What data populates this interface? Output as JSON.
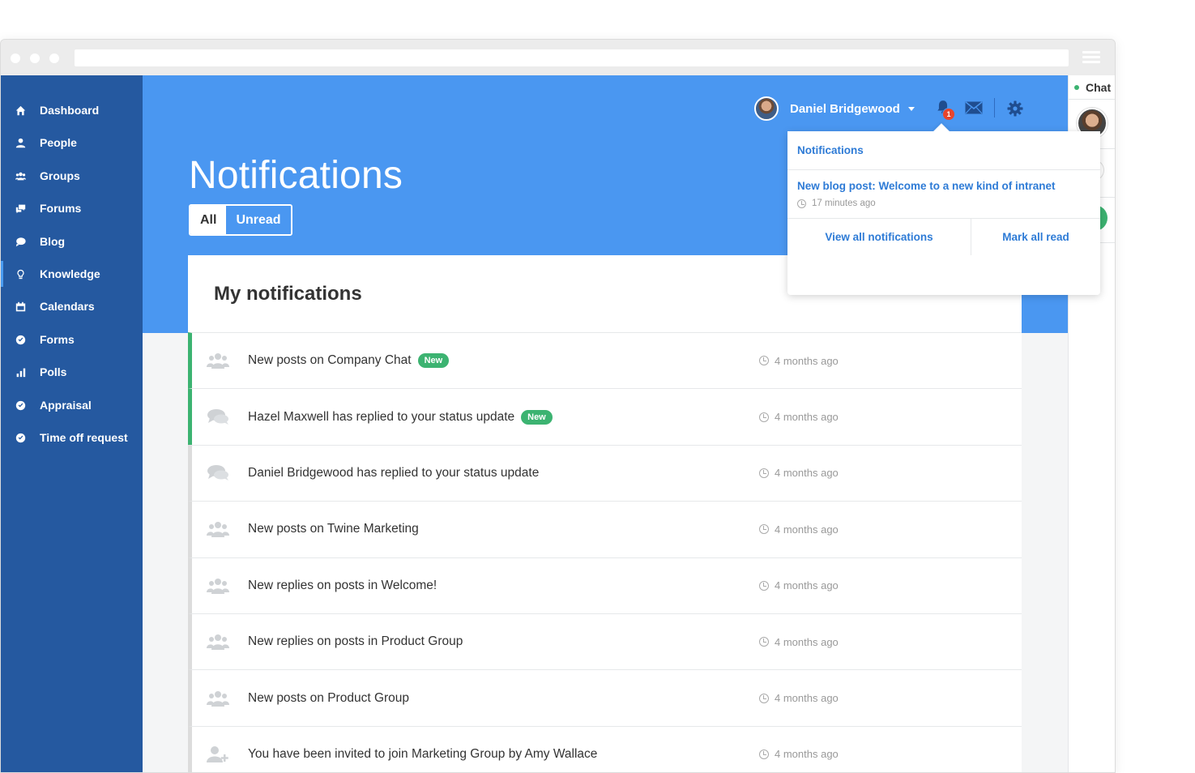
{
  "sidebar": {
    "items": [
      {
        "label": "Dashboard",
        "icon": "home-icon"
      },
      {
        "label": "People",
        "icon": "person-icon"
      },
      {
        "label": "Groups",
        "icon": "group-icon"
      },
      {
        "label": "Forums",
        "icon": "forum-icon"
      },
      {
        "label": "Blog",
        "icon": "speech-bubble-icon"
      },
      {
        "label": "Knowledge",
        "icon": "lightbulb-icon"
      },
      {
        "label": "Calendars",
        "icon": "calendar-icon"
      },
      {
        "label": "Forms",
        "icon": "check-circle-icon"
      },
      {
        "label": "Polls",
        "icon": "bar-chart-icon"
      },
      {
        "label": "Appraisal",
        "icon": "check-circle-icon"
      },
      {
        "label": "Time off request",
        "icon": "check-circle-icon"
      }
    ]
  },
  "header": {
    "title": "Notifications",
    "filter_all": "All",
    "filter_unread": "Unread",
    "user_name": "Daniel Bridgewood",
    "notification_count": "1"
  },
  "chat": {
    "label": "Chat"
  },
  "dropdown": {
    "title": "Notifications",
    "item_title": "New blog post: Welcome to a new kind of intranet",
    "item_time": "17 minutes ago",
    "view_all": "View all notifications",
    "mark_all": "Mark all read"
  },
  "main": {
    "title": "My notifications",
    "new_label": "New",
    "notifications": [
      {
        "text": "New posts on Company Chat",
        "time": "4 months ago",
        "icon": "group-icon",
        "is_new": true
      },
      {
        "text": "Hazel Maxwell has replied to your status update",
        "time": "4 months ago",
        "icon": "chat-bubbles-icon",
        "is_new": true
      },
      {
        "text": "Daniel Bridgewood has replied to your status update",
        "time": "4 months ago",
        "icon": "chat-bubbles-icon",
        "is_new": false
      },
      {
        "text": "New posts on Twine Marketing",
        "time": "4 months ago",
        "icon": "group-icon",
        "is_new": false
      },
      {
        "text": "New replies on posts in Welcome!",
        "time": "4 months ago",
        "icon": "group-icon",
        "is_new": false
      },
      {
        "text": "New replies on posts in Product Group",
        "time": "4 months ago",
        "icon": "group-icon",
        "is_new": false
      },
      {
        "text": "New posts on Product Group",
        "time": "4 months ago",
        "icon": "group-icon",
        "is_new": false
      },
      {
        "text": "You have been invited to join Marketing Group by Amy Wallace",
        "time": "4 months ago",
        "icon": "add-user-icon",
        "is_new": false
      }
    ]
  },
  "colors": {
    "sidebar": "#2559a0",
    "hero": "#4a97f1",
    "accent": "#2e7bd6",
    "new_badge": "#3cb371",
    "alert": "#e8452c"
  }
}
